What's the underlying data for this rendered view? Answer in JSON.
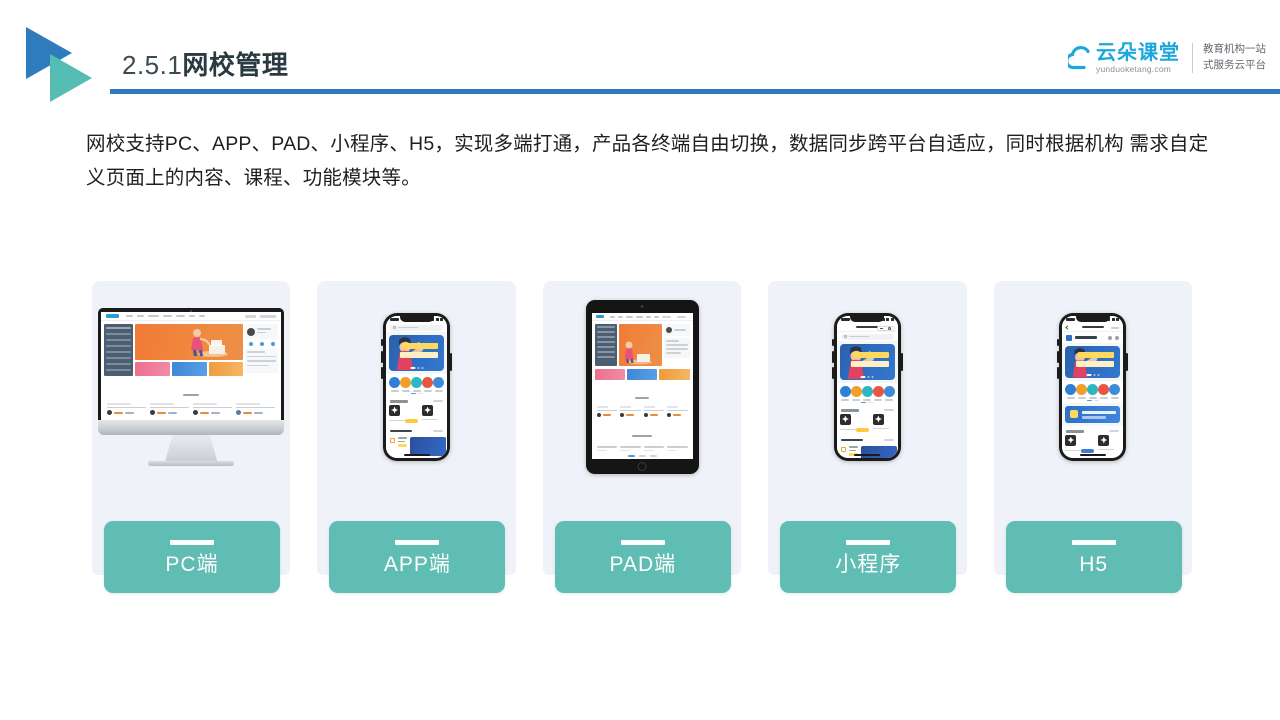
{
  "header": {
    "title_number": "2.5.1",
    "title_text": "网校管理",
    "logo_icon": "double-triangle-play-logo",
    "rule_color": "#2F79BE"
  },
  "brand": {
    "cloud_icon": "cloud-icon",
    "name_cn": "云朵课堂",
    "url": "yunduoketang.com",
    "slogan_line1": "教育机构一站",
    "slogan_line2": "式服务云平台",
    "accent_color": "#1CA7DD"
  },
  "body": {
    "paragraph_line1": "网校支持PC、APP、PAD、小程序、H5，实现多端打通，产品各终端自由切换，数据同步跨平台自适应，同时根据机构",
    "paragraph_line2": "需求自定义页面上的内容、课程、功能模块等。"
  },
  "cards": [
    {
      "label": "PC端",
      "device": "desktop-monitor",
      "device_icon": "imac-icon"
    },
    {
      "label": "APP端",
      "device": "smartphone",
      "device_icon": "phone-icon"
    },
    {
      "label": "PAD端",
      "device": "tablet",
      "device_icon": "tablet-icon"
    },
    {
      "label": "小程序",
      "device": "smartphone-miniprogram",
      "device_icon": "phone-icon"
    },
    {
      "label": "H5",
      "device": "smartphone-browser",
      "device_icon": "phone-icon"
    }
  ],
  "theme": {
    "label_box_color": "#5FBDB3",
    "card_background": "#EFF2F8",
    "hero_orange": "#F07B36",
    "banner_blue": "#2D6CC0",
    "page_background": "#FFFFFF"
  }
}
